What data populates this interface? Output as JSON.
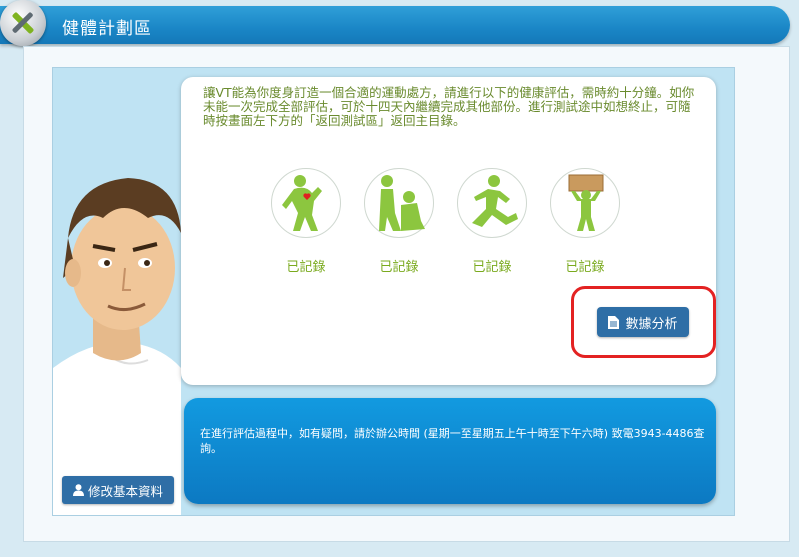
{
  "header": {
    "title": "健體計劃區"
  },
  "intro": {
    "text": "讓VT能為你度身訂造一個合適的運動處方，請進行以下的健康評估，需時約十分鐘。如你未能一次完成全部評估，可於十四天內繼續完成其他部份。進行測試途中如想終止，可隨時按畫面左下方的「返回測試區」返回主目錄。"
  },
  "assessments": [
    {
      "icon": "heart-figure-icon",
      "label": "已記錄"
    },
    {
      "icon": "sit-reach-figure-icon",
      "label": "已記錄"
    },
    {
      "icon": "running-figure-icon",
      "label": "已記錄"
    },
    {
      "icon": "lifting-figure-icon",
      "label": "已記錄"
    }
  ],
  "analysis_button": {
    "label": "數據分析",
    "icon": "document-icon"
  },
  "info": {
    "text": "在進行評估過程中，如有疑問，請於辦公時間 (星期一至星期五上午十時至下午六時) 致電3943-4486查詢。"
  },
  "edit_profile_button": {
    "label": "修改基本資料",
    "icon": "user-icon"
  },
  "colors": {
    "header": "#1a86c6",
    "text_green": "#6a8b2e",
    "label_green": "#7aaa1e",
    "button_blue": "#2e6ea6",
    "highlight_red": "#e32222"
  }
}
